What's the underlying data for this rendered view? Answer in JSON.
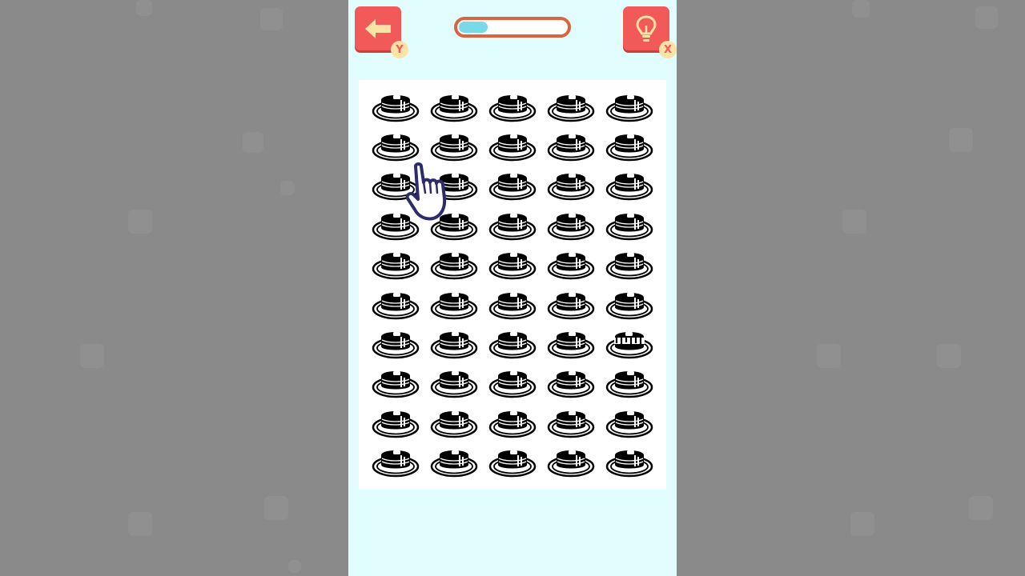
{
  "game": {
    "back_key": "Y",
    "hint_key": "X",
    "progress_percent": 26,
    "grid": {
      "columns": 5,
      "rows": 10
    },
    "cell_icon": "pancake-stack-on-plate-icon",
    "odd_icon": "pancake-stack-with-syrup-icon",
    "odd_cell": {
      "row": 7,
      "column": 5
    },
    "pointer_icon": "tutorial-hand-pointer-icon"
  },
  "colors": {
    "background_side": "#8a8a8a",
    "background_game": "#e1fdfd",
    "button": "#f25a5a",
    "badge": "#fbe3a6",
    "progress_border": "#d9643f",
    "progress_fill": "#7ad9e6",
    "hand_outline": "#2d2b6b"
  }
}
